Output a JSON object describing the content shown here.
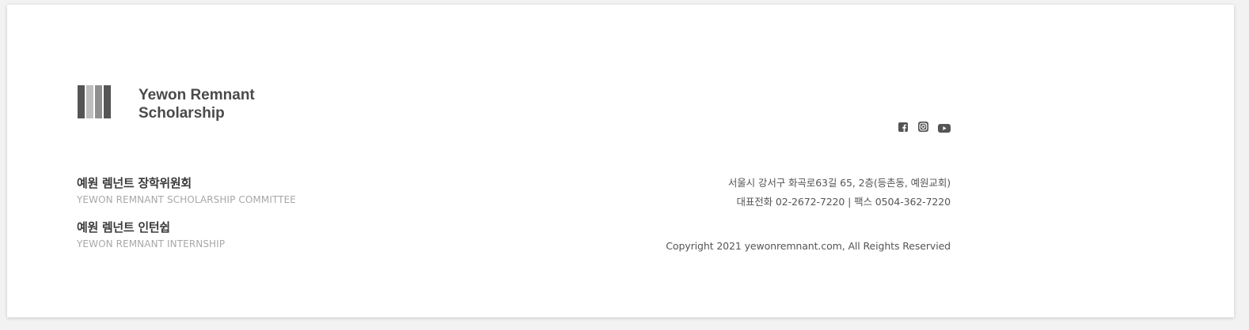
{
  "brand": {
    "name_line1": "Yewon Remnant",
    "name_line2": "Scholarship",
    "bar_colors": [
      "#555555",
      "#bdbdbd",
      "#8f8f8f",
      "#555555"
    ]
  },
  "social": {
    "icons": [
      "facebook-icon",
      "instagram-icon",
      "youtube-icon"
    ],
    "color": "#555555"
  },
  "organizations": [
    {
      "name_ko": "예원 렘넌트 장학위원회",
      "name_en": "YEWON REMNANT SCHOLARSHIP COMMITTEE"
    },
    {
      "name_ko": "예원 렘넌트 인턴쉽",
      "name_en": "YEWON REMNANT INTERNSHIP"
    }
  ],
  "contact": {
    "address": "서울시 강서구 화곡로63길 65, 2층(등촌동, 예원교회)",
    "phone": "대표전화 02-2672-7220 | 팩스 0504-362-7220",
    "copyright": "Copyright 2021 yewonremnant.com, All Reights Reservied"
  }
}
